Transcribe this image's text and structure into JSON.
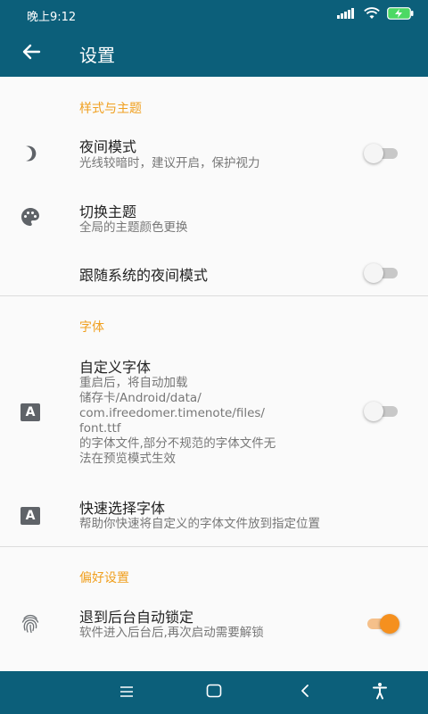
{
  "status_bar": {
    "time": "晚上9:12",
    "icons": [
      "signal-icon",
      "wifi-icon",
      "battery-charging-icon"
    ]
  },
  "app_bar": {
    "title": "设置",
    "back_icon": "arrow-back-icon"
  },
  "sections": {
    "style": {
      "title": "样式与主题",
      "night_mode": {
        "title": "夜间模式",
        "subtitle": "光线较暗时，建议开启，保护视力",
        "icon": "moon-icon",
        "enabled": false
      },
      "theme": {
        "title": "切换主题",
        "subtitle": "全局的主题颜色更换",
        "icon": "palette-icon"
      },
      "follow_system": {
        "title": "跟随系统的夜间模式",
        "enabled": false
      }
    },
    "font": {
      "title": "字体",
      "custom_font": {
        "title": "自定义字体",
        "subtitle_lines": [
          "重启后，将自动加载",
          "储存卡/Android/data/",
          "com.ifreedomer.timenote/files/",
          "font.ttf",
          "的字体文件,部分不规范的字体文件无",
          "法在预览模式生效"
        ],
        "icon": "font-icon",
        "enabled": false
      },
      "quick_select": {
        "title": "快速选择字体",
        "subtitle": "帮助你快速将自定义的字体文件放到指定位置",
        "icon": "font-icon"
      }
    },
    "preference": {
      "title": "偏好设置",
      "auto_lock": {
        "title": "退到后台自动锁定",
        "subtitle": "软件进入后台后,再次启动需要解锁",
        "icon": "fingerprint-icon",
        "enabled": true
      }
    }
  },
  "nav_bar": {
    "buttons": [
      "menu-icon",
      "home-icon",
      "back-icon",
      "accessibility-icon"
    ]
  },
  "colors": {
    "primary": "#0c5f7a",
    "accent": "#f0a020",
    "switch_on": "#f5901e"
  }
}
